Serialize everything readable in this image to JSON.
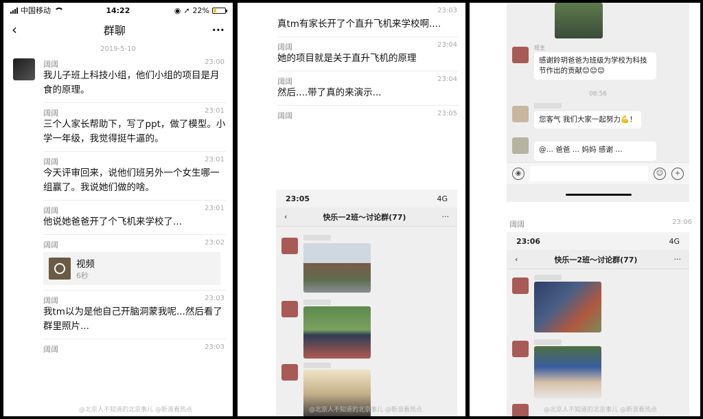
{
  "status": {
    "carrier": "中国移动",
    "time": "14:22",
    "battery": "22%"
  },
  "panel1": {
    "title": "群聊",
    "date": "2019-5-10",
    "messages": [
      {
        "name": "阔阔",
        "time": "23:00",
        "text": "我儿子班上科技小组，他们小组的项目是月食的原理。"
      },
      {
        "name": "阔阔",
        "time": "23:01",
        "text": "三个人家长帮助下，写了ppt，做了模型。小学一年级，我觉得挺牛逼的。"
      },
      {
        "name": "阔阔",
        "time": "23:01",
        "text": "今天评审回来，说他们班另外一个女生哪一组赢了。我说她们做的啥。"
      },
      {
        "name": "阔阔",
        "time": "23:01",
        "text": "他说她爸爸开了个飞机来学校了..."
      },
      {
        "name": "阔阔",
        "time": "23:02",
        "video_label": "视频",
        "video_duration": "6秒"
      },
      {
        "name": "阔阔",
        "time": "23:03",
        "text": "我tm以为是他自己开脑洞蒙我呢...然后看了群里照片..."
      },
      {
        "name": "阔阔",
        "time": "23:03",
        "text": ""
      }
    ],
    "watermark": "@北京人不知道的北京事儿  @新浪看热点"
  },
  "panel2": {
    "messages": [
      {
        "name": "",
        "time": "23:03",
        "text": "真tm有家长开了个直升飞机来学校啊...."
      },
      {
        "name": "阔阔",
        "time": "23:04",
        "text": "她的项目就是关于直升飞机的原理"
      },
      {
        "name": "阔阔",
        "time": "23:04",
        "text": "然后....带了真的来演示..."
      },
      {
        "name": "阔阔",
        "time": "23:05",
        "text": ""
      }
    ],
    "shot": {
      "time": "23:05",
      "net": "4G",
      "title": "快乐一2班～讨论群(77)"
    },
    "watermark": "@北京人不知道的北京事儿  @新浪看热点"
  },
  "panel3": {
    "top_chat": [
      {
        "name": "班主",
        "text": "感谢鈴玥爸爸为班级为学校为科技节作出的贡献😊😊😊"
      },
      {
        "time_sep": "08:56"
      },
      {
        "text": "您客气 我们大家一起努力💪！"
      },
      {
        "text": "@… 爸爸 … 妈妈 感谢 …"
      }
    ],
    "msg": {
      "name": "阔阔",
      "time": "23:06"
    },
    "shot": {
      "time": "23:06",
      "net": "4G",
      "title": "快乐一2班～讨论群(77)"
    },
    "watermark": "@北京人不知道的北京事儿  @新浪看热点"
  }
}
